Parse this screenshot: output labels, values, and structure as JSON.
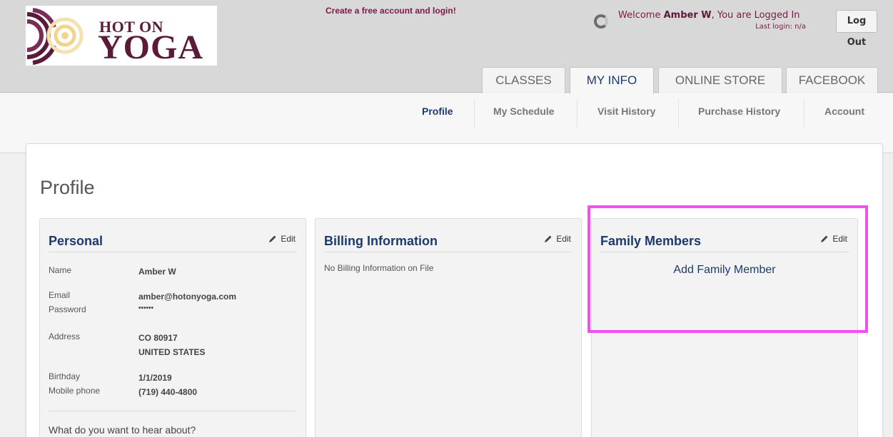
{
  "brand": {
    "line1": "HOT ON",
    "line2": "YOGA"
  },
  "header": {
    "promo_link": "Create a free account and login!",
    "welcome_prefix": "Welcome ",
    "user_name": "Amber W",
    "welcome_suffix": ", You are Logged In",
    "last_login": "Last login: n/a",
    "logout_label": "Log Out"
  },
  "tabs": [
    {
      "label": "CLASSES"
    },
    {
      "label": "MY INFO"
    },
    {
      "label": "ONLINE STORE"
    },
    {
      "label": "FACEBOOK"
    }
  ],
  "subnav": [
    {
      "label": "Profile"
    },
    {
      "label": "My Schedule"
    },
    {
      "label": "Visit History"
    },
    {
      "label": "Purchase History"
    },
    {
      "label": "Account"
    }
  ],
  "page_title": "Profile",
  "edit_label": "Edit",
  "personal": {
    "title": "Personal",
    "name_label": "Name",
    "name": "Amber W",
    "email_label": "Email",
    "email": "amber@hotonyoga.com",
    "password_label": "Password",
    "password": "••••••",
    "address_label": "Address",
    "address_line1": "CO 80917",
    "address_line2": "UNITED STATES",
    "birthday_label": "Birthday",
    "birthday": "1/1/2019",
    "mobile_label": "Mobile phone",
    "mobile": "(719) 440-4800",
    "preferences_question": "What do you want to hear about?"
  },
  "billing": {
    "title": "Billing Information",
    "empty_text": "No Billing Information on File"
  },
  "family": {
    "title": "Family Members",
    "add_link": "Add Family Member"
  },
  "colors": {
    "brand_maroon": "#5a1a3a",
    "link_navy": "#1d3a6d",
    "highlight_magenta": "#f24ef0"
  }
}
